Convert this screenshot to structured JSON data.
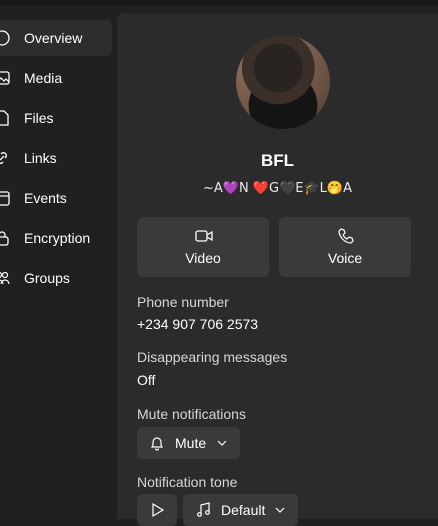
{
  "sidebar": {
    "items": [
      {
        "label": "Overview",
        "icon": "info-icon",
        "active": true
      },
      {
        "label": "Media",
        "icon": "image-icon"
      },
      {
        "label": "Files",
        "icon": "file-icon"
      },
      {
        "label": "Links",
        "icon": "link-icon"
      },
      {
        "label": "Events",
        "icon": "calendar-icon"
      },
      {
        "label": "Encryption",
        "icon": "lock-icon"
      },
      {
        "label": "Groups",
        "icon": "people-icon"
      }
    ]
  },
  "profile": {
    "name": "BFL",
    "status": "~A💜N ❤️G🖤E🎓L🤭A"
  },
  "call": {
    "video_label": "Video",
    "voice_label": "Voice"
  },
  "phone": {
    "label": "Phone number",
    "value": "+234 907 706 2573"
  },
  "disappearing": {
    "label": "Disappearing messages",
    "value": "Off"
  },
  "mute": {
    "label": "Mute notifications",
    "button_label": "Mute"
  },
  "tone": {
    "label": "Notification tone",
    "select_value": "Default"
  },
  "colors": {
    "background": "#202020",
    "panel": "#2b2b2b",
    "button": "#3a3a3a",
    "active_nav": "#2d2d2d"
  }
}
